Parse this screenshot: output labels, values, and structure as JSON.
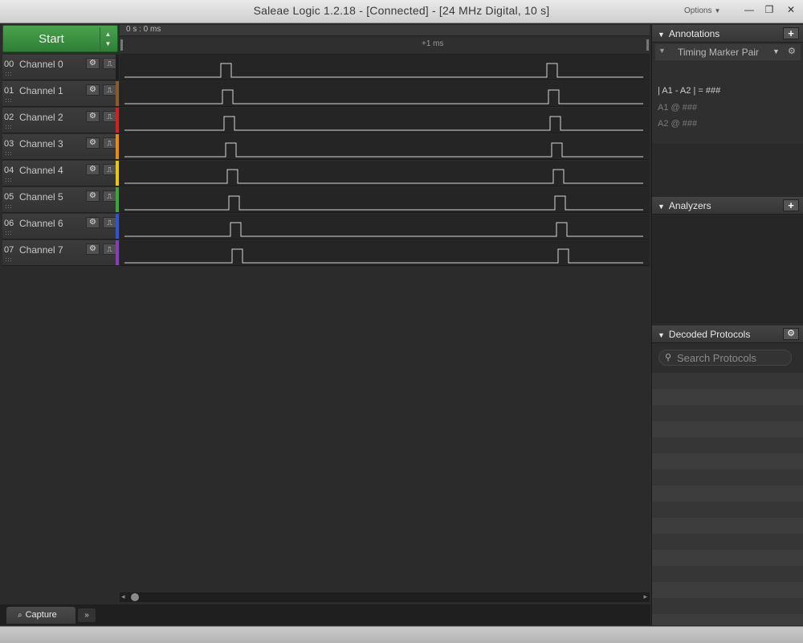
{
  "window": {
    "title": "Saleae Logic 1.2.18 - [Connected] - [24 MHz Digital, 10 s]",
    "options_label": "Options",
    "min_icon": "minimize-icon",
    "max_icon": "restore-icon",
    "close_icon": "close-icon"
  },
  "start": {
    "label": "Start",
    "spinner_up": "▲",
    "spinner_down": "▼"
  },
  "channels": [
    {
      "num": "00",
      "name": "Channel 0",
      "color": "#1e1e1e"
    },
    {
      "num": "01",
      "name": "Channel 1",
      "color": "#8b5a2b"
    },
    {
      "num": "02",
      "name": "Channel 2",
      "color": "#d32222"
    },
    {
      "num": "03",
      "name": "Channel 3",
      "color": "#e58a1c"
    },
    {
      "num": "04",
      "name": "Channel 4",
      "color": "#e8c51d"
    },
    {
      "num": "05",
      "name": "Channel 5",
      "color": "#3aa63a"
    },
    {
      "num": "06",
      "name": "Channel 6",
      "color": "#3355cc"
    },
    {
      "num": "07",
      "name": "Channel 7",
      "color": "#8a3cb8"
    }
  ],
  "channel_buttons": {
    "gear": "⚙",
    "trigger": "⎍"
  },
  "timeline": {
    "start_time": "0 s : 0 ms",
    "marker": "+1 ms"
  },
  "tabs": {
    "capture_label": "Capture",
    "more_label": "»"
  },
  "right_panel": {
    "annotations": {
      "title": "Annotations",
      "add": "+",
      "marker_pair_label": "Timing Marker Pair",
      "line1": "| A1 - A2 | = ###",
      "line2": "A1  @  ###",
      "line3": "A2  @  ###"
    },
    "analyzers": {
      "title": "Analyzers",
      "add": "+"
    },
    "decoded_protocols": {
      "title": "Decoded Protocols",
      "gear": "⚙",
      "search_placeholder": "Search Protocols"
    }
  }
}
